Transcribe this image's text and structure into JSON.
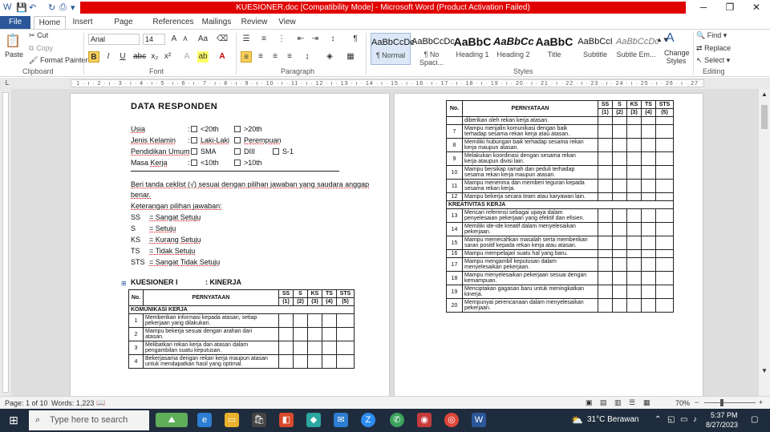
{
  "window": {
    "title": "KUESIONER.doc [Compatibility Mode] - Microsoft Word (Product Activation Failed)"
  },
  "tabs": [
    "File",
    "Home",
    "Insert",
    "Page Layout",
    "References",
    "Mailings",
    "Review",
    "View"
  ],
  "ribbon": {
    "clipboard": {
      "paste": "Paste",
      "cut": "Cut",
      "copy": "Copy",
      "format_painter": "Format Painter",
      "group": "Clipboard"
    },
    "font": {
      "name": "Arial",
      "size": "14",
      "group": "Font"
    },
    "paragraph": {
      "group": "Paragraph"
    },
    "styles": {
      "items": [
        {
          "sample": "AaBbCcDc",
          "name": "¶ Normal"
        },
        {
          "sample": "AaBbCcDc",
          "name": "¶ No Spaci..."
        },
        {
          "sample": "AaBbC",
          "name": "Heading 1"
        },
        {
          "sample": "AaBbCc",
          "name": "Heading 2"
        },
        {
          "sample": "AaBbC",
          "name": "Title"
        },
        {
          "sample": "AaBbCcI",
          "name": "Subtitle"
        },
        {
          "sample": "AaBbCcDc",
          "name": "Subtle Em..."
        }
      ],
      "change": "Change Styles",
      "group": "Styles"
    },
    "editing": {
      "find": "Find",
      "replace": "Replace",
      "select": "Select",
      "group": "Editing"
    }
  },
  "doc": {
    "page1": {
      "heading": "DATA RESPONDEN",
      "fields": [
        {
          "label": "Usia",
          "opts": [
            "<20th",
            ">20th"
          ]
        },
        {
          "label": "Jenis Kelamin",
          "opts": [
            "Laki-Laki",
            "Perempuan"
          ]
        },
        {
          "label": "Pendidikan Umum",
          "opts": [
            "SMA",
            "DIII",
            "S-1"
          ]
        },
        {
          "label": "Masa Kerja",
          "opts": [
            "<10th",
            ">10th"
          ]
        }
      ],
      "instruction": "Beri tanda ceklist (√) sesuai dengan pilihan jawaban yang saudara anggap",
      "instruction2": "benar.",
      "legend_title": "Keterangan pilihan jawaban:",
      "legend": [
        {
          "k": "SS",
          "v": "= Sangat Setuju"
        },
        {
          "k": "S",
          "v": "= Setuju"
        },
        {
          "k": "KS",
          "v": "= Kurang Setuju"
        },
        {
          "k": "TS",
          "v": "= Tidak Setuju"
        },
        {
          "k": "STS",
          "v": "= Sangat Tidak Setuju"
        }
      ],
      "kuesioner": "KUESIONER I",
      "kuesioner_name": ": KINERJA",
      "section": "KOMUNIKASI KERJA",
      "rows": [
        {
          "no": "1",
          "text": [
            "Memberikan informasi kepada atasan, setiap",
            "pekerjaan yang dilakukan."
          ]
        },
        {
          "no": "2",
          "text": [
            "Mampu bekerja sesuai dengan arahan dari",
            "atasan."
          ]
        },
        {
          "no": "3",
          "text": [
            "Melibatkan rekan kerja dan atasan dalam",
            "pengambilan suatu keputusan."
          ]
        },
        {
          "no": "4",
          "text": [
            "Bekerjasama dengan rekan kerja maupun atasan",
            "untuk mendapatkan hasil yang optimal."
          ]
        }
      ]
    },
    "table_header": {
      "no": "No.",
      "statement": "PERNYATAAN",
      "cols": [
        "SS",
        "S",
        "KS",
        "TS",
        "STS"
      ],
      "nums": [
        "(1)",
        "(2)",
        "(3)",
        "(4)",
        "(5)"
      ]
    },
    "page2": {
      "cont": "diberikan oleh rekan kerja atasan.",
      "rows_a": [
        {
          "no": "7",
          "text": [
            "Mampu menjalin komunikasi dengan baik",
            "terhadap sesama rekan kerja atau atasan."
          ]
        },
        {
          "no": "8",
          "text": [
            "Memiliki hubungan baik terhadap sesama rekan",
            "kerja maupun atasan."
          ]
        },
        {
          "no": "9",
          "text": [
            "Melakukan koordinasi dengan sesama rekan",
            "kerja ataupun divisi lain."
          ]
        },
        {
          "no": "10",
          "text": [
            "Mampu bersikap ramah dan peduli terhadap",
            "sesama rekan kerja maupun atasan."
          ]
        },
        {
          "no": "11",
          "text": [
            "Mampu menerima dan memberi teguran kepada",
            "sesama rekan kerja."
          ]
        },
        {
          "no": "12",
          "text": [
            "Mampu bekerja secara team atau karyawan lain."
          ]
        }
      ],
      "section": "KREATIVITAS KERJA",
      "rows_b": [
        {
          "no": "13",
          "text": [
            "Mencari referensi sebagai upaya dalam",
            "penyelesaian pekerjaan yang efektif dan efisien."
          ]
        },
        {
          "no": "14",
          "text": [
            "Memiliki ide-ide kreatif dalam menyelesaikan",
            "pekerjaan."
          ]
        },
        {
          "no": "15",
          "text": [
            "Mampu memecahkan masalah serta memberikan",
            "saran positif kepada rekan kerja atau atasan."
          ]
        },
        {
          "no": "16",
          "text": [
            "Mampu mempelajari suatu hal yang baru."
          ]
        },
        {
          "no": "17",
          "text": [
            "Mampu mengambil keputusan dalam",
            "menyelesaikan pekerjaan."
          ]
        },
        {
          "no": "18",
          "text": [
            "Mampu menyelesaikan pekerjaan sesuai dengan",
            "kemampuan."
          ]
        },
        {
          "no": "19",
          "text": [
            "Menciptakan gagasan baru untuk meningkatkan",
            "kinerja."
          ]
        },
        {
          "no": "20",
          "text": [
            "Mempunyai perencanaan dalam menyelesaikan",
            "pekerjaan."
          ]
        }
      ]
    }
  },
  "status": {
    "page": "Page: 1 of 10",
    "words": "Words: 1,223",
    "zoom": "70%"
  },
  "taskbar": {
    "search": "Type here to search",
    "weather": "31°C  Berawan",
    "time": "5:37 PM",
    "date": "8/27/2023"
  }
}
